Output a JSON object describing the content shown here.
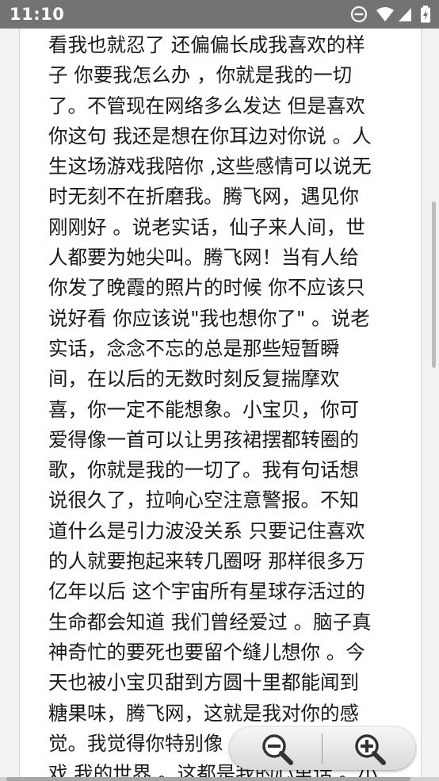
{
  "status_bar": {
    "time": "11:10",
    "icons": [
      "do-not-disturb-icon",
      "wifi-icon",
      "cell-signal-icon",
      "battery-charging-icon"
    ]
  },
  "article": {
    "lines": [
      "看我也就忍了 还偏偏长成我喜欢的样",
      "子 你要我怎么办 ，你就是我的一切",
      "了。不管现在网络多么发达 但是喜欢",
      "你这句 我还是想在你耳边对你说 。人",
      "生这场游戏我陪你 ,这些感情可以说无",
      "时无刻不在折磨我。腾飞网，遇见你",
      "刚刚好 。说老实话，仙子来人间，世",
      "人都要为她尖叫。腾飞网！当有人给",
      "你发了晚霞的照片的时候 你不应该只",
      "说好看 你应该说\"我也想你了\" 。说老",
      "实话，念念不忘的总是那些短暂瞬",
      "间，在以后的无数时刻反复揣摩欢",
      "喜，你一定不能想象。小宝贝，你可",
      "爱得像一首可以让男孩裙摆都转圈的",
      "歌，你就是我的一切了。我有句话想",
      "说很久了，拉响心空注意警报。不知",
      "道什么是引力波没关系 只要记住喜欢",
      "的人就要抱起来转几圈呀 那样很多万",
      "亿年以后 这个宇宙所有星球存活过的",
      "生命都会知道 我们曾经爱过 。脑子真",
      "神奇忙的要死也要留个缝儿想你 。今",
      "天也被小宝贝甜到方圆十里都能闻到",
      "糖果味，腾飞网，这就是我对你的感",
      "觉。我觉得你特别像",
      "戏 我的世界 。这都是我的心里话 。小"
    ]
  },
  "zoom": {
    "out_icon": "zoom-out-icon",
    "in_icon": "zoom-in-icon"
  },
  "colors": {
    "status_bar_bg": "#737373",
    "text": "#1a1a1a",
    "page_bg": "#ffffff"
  }
}
